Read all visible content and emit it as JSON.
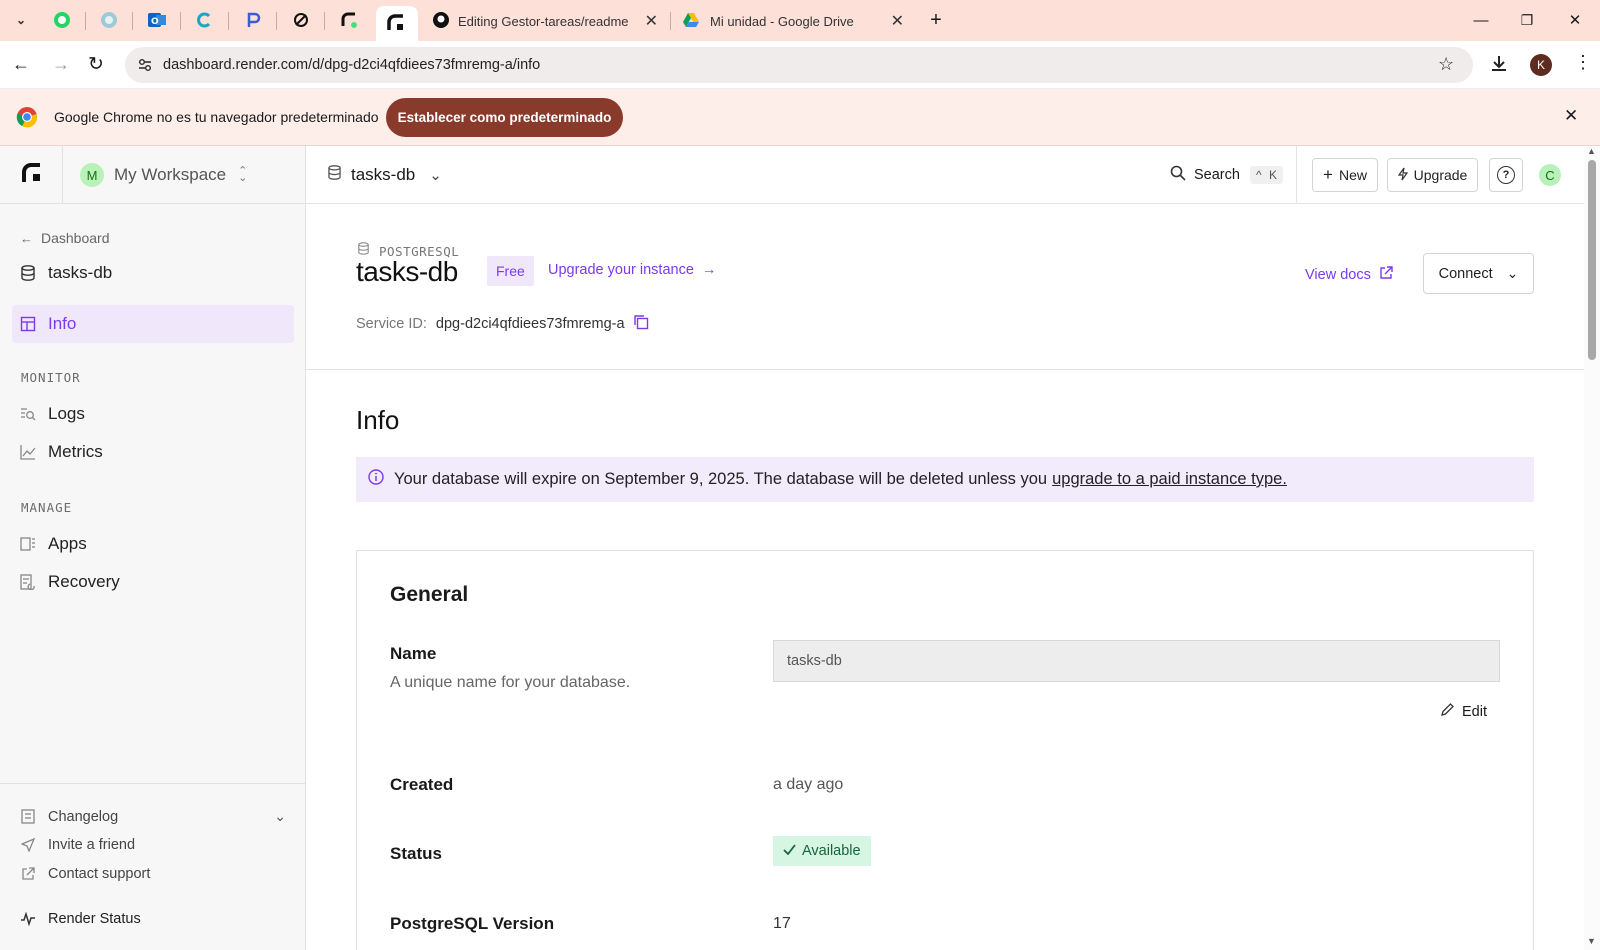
{
  "browser": {
    "tabs": [
      {
        "title": "Editing Gestor-tareas/readme.t"
      },
      {
        "title": "Mi unidad - Google Drive"
      }
    ],
    "url": "dashboard.render.com/d/dpg-d2ci4qfdiees73fmremg-a/info",
    "profile_initial": "K",
    "infobar_text": "Google Chrome no es tu navegador predeterminado",
    "infobar_button": "Establecer como predeterminado"
  },
  "workspace": {
    "initial": "M",
    "name": "My Workspace"
  },
  "service_selector": "tasks-db",
  "topbar": {
    "search": "Search",
    "shortcut_mod": "^",
    "shortcut_key": "K",
    "new": "New",
    "upgrade": "Upgrade",
    "help": "?",
    "avatar": "C"
  },
  "sidebar": {
    "back": "Dashboard",
    "service": "tasks-db",
    "info": "Info",
    "monitor_heading": "MONITOR",
    "logs": "Logs",
    "metrics": "Metrics",
    "manage_heading": "MANAGE",
    "apps": "Apps",
    "recovery": "Recovery",
    "changelog": "Changelog",
    "invite": "Invite a friend",
    "support": "Contact support",
    "status": "Render Status"
  },
  "header": {
    "type_label": "POSTGRESQL",
    "name": "tasks-db",
    "plan_badge": "Free",
    "upgrade_link": "Upgrade your instance",
    "service_id_label": "Service ID:",
    "service_id": "dpg-d2ci4qfdiees73fmremg-a",
    "view_docs": "View docs",
    "connect": "Connect"
  },
  "info": {
    "title": "Info",
    "banner_text": "Your database will expire on September 9, 2025. The database will be deleted unless you",
    "banner_link": "upgrade to a paid instance type."
  },
  "general": {
    "title": "General",
    "name_label": "Name",
    "name_desc": "A unique name for your database.",
    "name_value": "tasks-db",
    "edit": "Edit",
    "created_label": "Created",
    "created_value": "a day ago",
    "status_label": "Status",
    "status_value": "Available",
    "version_label": "PostgreSQL Version",
    "version_value": "17"
  },
  "colors": {
    "accent": "#7c3aed",
    "tab_bar": "#fde0d8",
    "status_green": "#d7f5e3"
  }
}
